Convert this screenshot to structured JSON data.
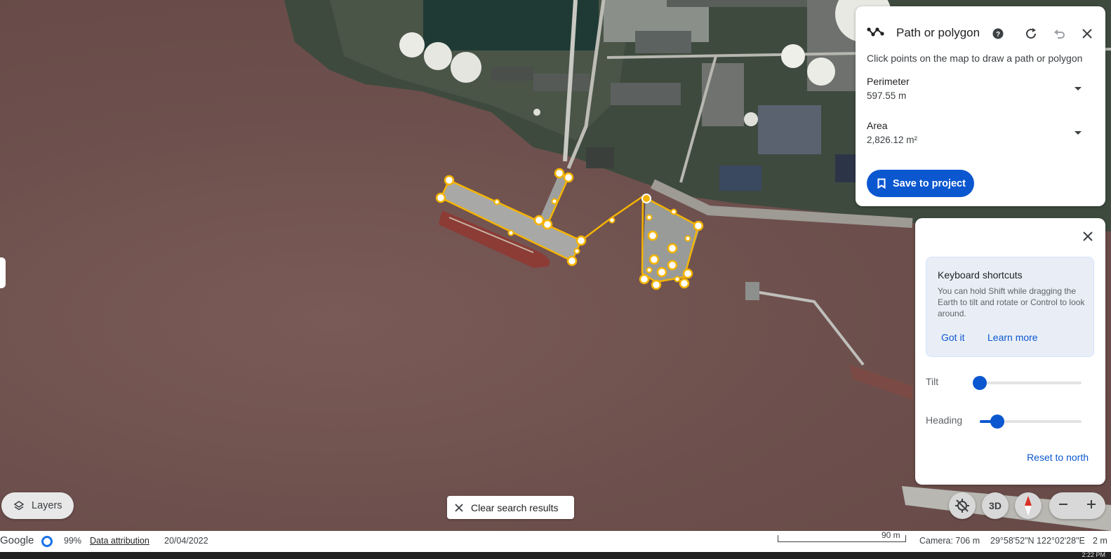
{
  "panel": {
    "title": "Path or polygon",
    "hint": "Click points on the map to draw a path or polygon",
    "perimeter_label": "Perimeter",
    "perimeter_value": "597.55 m",
    "area_label": "Area",
    "area_value": "2,826.12 m²",
    "save_label": "Save to project"
  },
  "nav": {
    "tip_title": "Keyboard shortcuts",
    "tip_body": "You can hold Shift while dragging the Earth to tilt and rotate or Control to look around.",
    "got_it": "Got it",
    "learn_more": "Learn more",
    "tilt_label": "Tilt",
    "tilt_value": 0,
    "heading_label": "Heading",
    "heading_value": 0.17,
    "reset_label": "Reset to north"
  },
  "controls": {
    "layers_label": "Layers",
    "clear_label": "Clear search results",
    "view_3d_label": "3D"
  },
  "status": {
    "brand": "Google",
    "load_percent": "99%",
    "attribution": "Data attribution",
    "date": "20/04/2022",
    "scale": "90 m",
    "camera": "Camera: 706 m",
    "coords": "29°58'52\"N 122°02'28\"E",
    "elevation": "2 m",
    "clock": "2:22 PM"
  },
  "colors": {
    "accent": "#0b57d0",
    "path": "#f5b400",
    "water": "#6d504d"
  }
}
